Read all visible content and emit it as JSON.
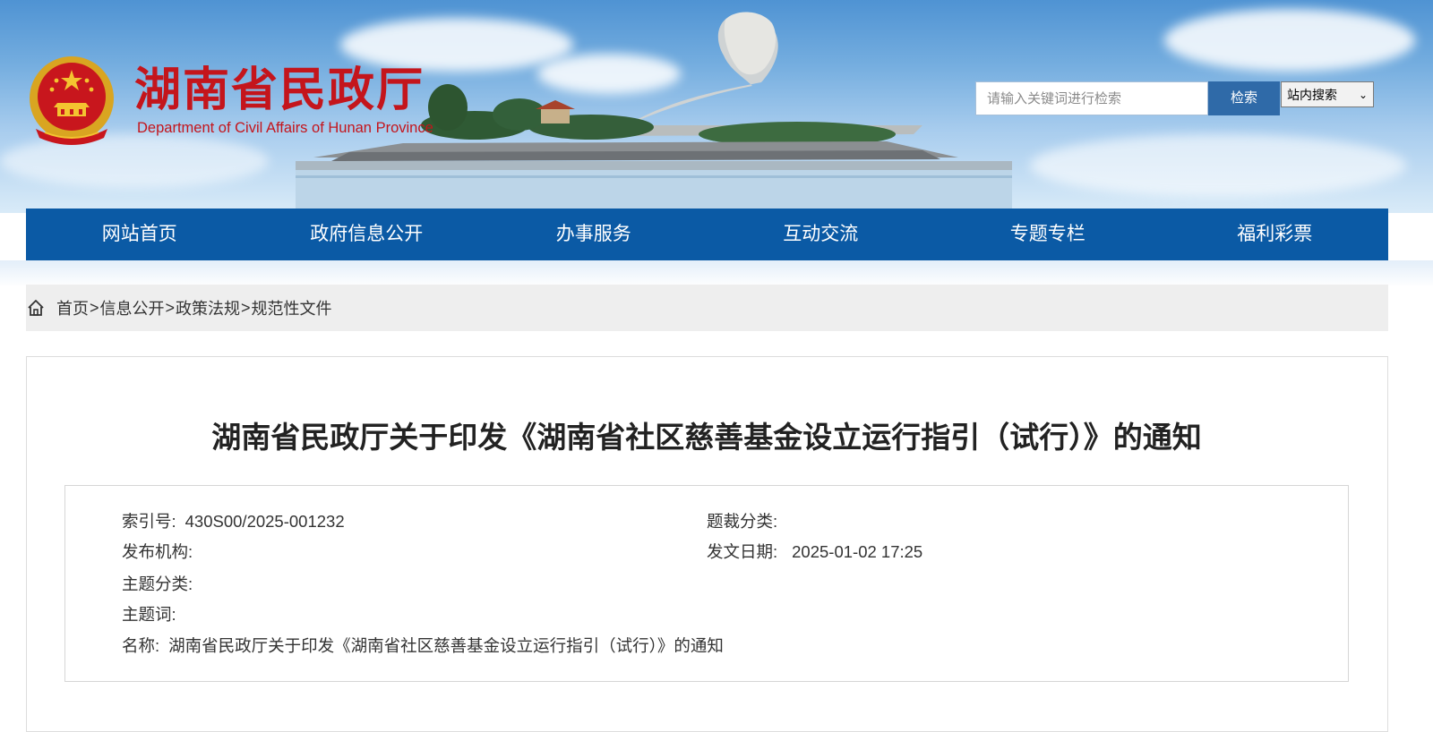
{
  "header": {
    "title": "湖南省民政厅",
    "subtitle": "Department of Civil Affairs of Hunan Province",
    "search": {
      "placeholder": "请输入关键词进行检索",
      "button_label": "检索",
      "scope_selected": "站内搜索"
    }
  },
  "nav": {
    "items": [
      {
        "label": "网站首页"
      },
      {
        "label": "政府信息公开"
      },
      {
        "label": "办事服务"
      },
      {
        "label": "互动交流"
      },
      {
        "label": "专题专栏"
      },
      {
        "label": "福利彩票"
      }
    ]
  },
  "breadcrumb": {
    "items": [
      "首页",
      "信息公开",
      "政策法规",
      "规范性文件"
    ],
    "separator": ">"
  },
  "article": {
    "title": "湖南省民政厅关于印发《湖南省社区慈善基金设立运行指引（试行）》的通知",
    "meta": {
      "index_label": "索引号:",
      "index_value": "430S00/2025-001232",
      "genre_label": "题裁分类:",
      "genre_value": "",
      "publisher_label": "发布机构:",
      "publisher_value": "",
      "date_label": "发文日期:",
      "date_value": "2025-01-02 17:25",
      "topic_label": "主题分类:",
      "topic_value": "",
      "keywords_label": "主题词:",
      "keywords_value": "",
      "name_label": "名称:",
      "name_value": "湖南省民政厅关于印发《湖南省社区慈善基金设立运行指引（试行）》的通知"
    }
  },
  "colors": {
    "nav_bg": "#0b5aa5",
    "title_red": "#c4151c",
    "search_button": "#2f6aa8"
  }
}
